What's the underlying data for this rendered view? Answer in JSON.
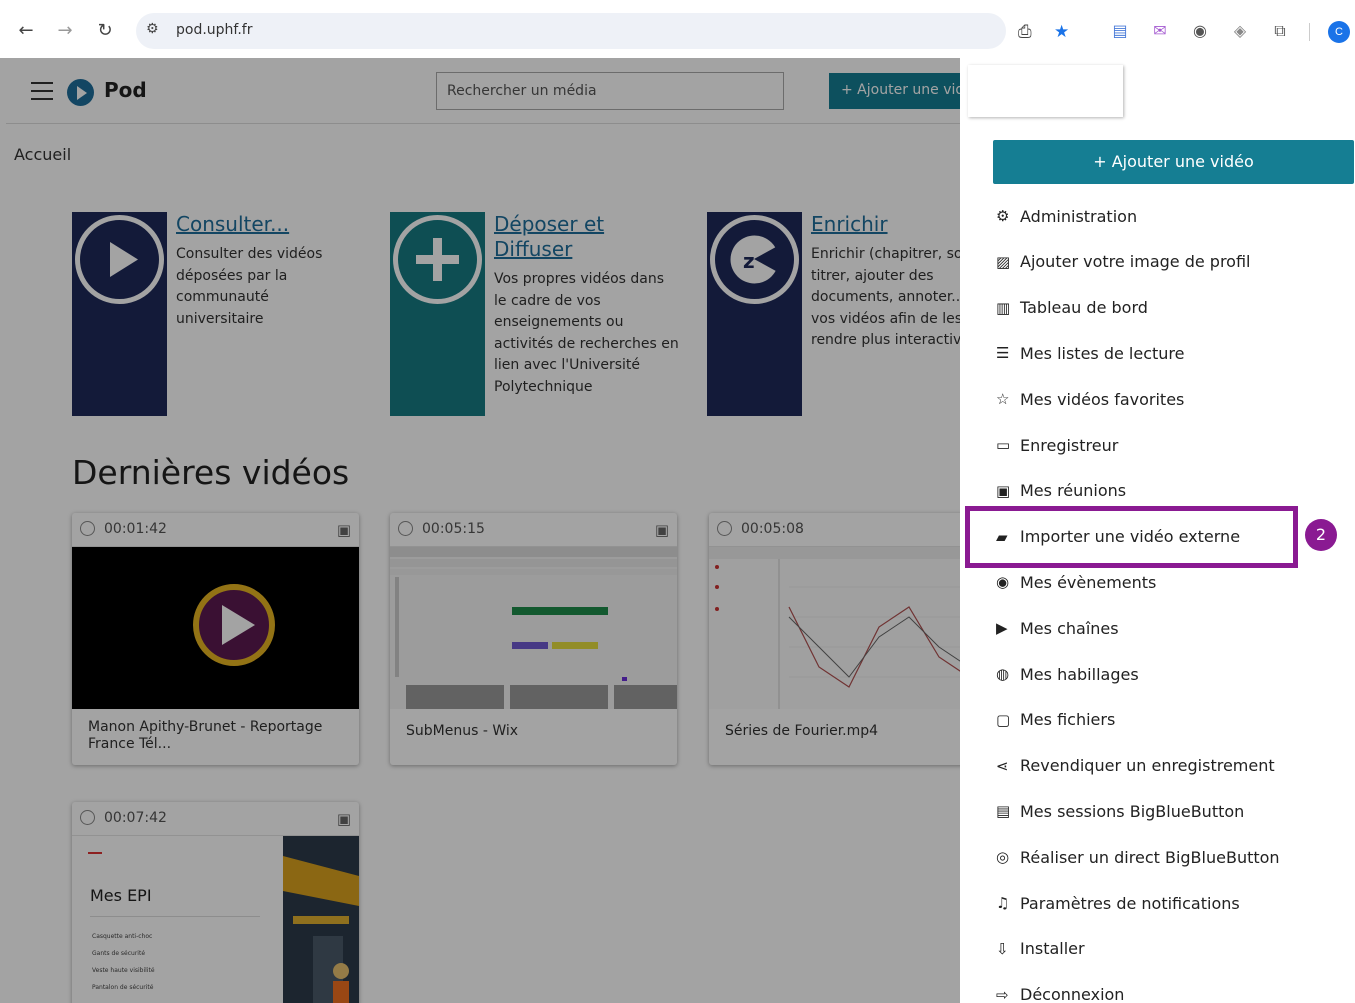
{
  "browser": {
    "url": "pod.uphf.fr",
    "profile_initial": "C"
  },
  "app": {
    "name": "Pod",
    "search_placeholder": "Rechercher un média",
    "add_button_top": "+  Ajouter une vidéo",
    "breadcrumb": "Accueil"
  },
  "features": [
    {
      "title": "Consulter...",
      "description": "Consulter des vidéos déposées par la communauté universitaire"
    },
    {
      "title": "Déposer et Diffuser",
      "description": "Vos propres vidéos dans le cadre de vos enseignements ou activités de recherches en lien avec l'Université Polytechnique"
    },
    {
      "title": "Enrichir",
      "description": "Enrichir (chapitrer, sous-titrer, ajouter des documents, annoter...) vos vidéos afin de les rendre plus interactives"
    }
  ],
  "latest": {
    "heading": "Dernières vidéos",
    "videos": [
      {
        "duration": "00:01:42",
        "title": "Manon Apithy-Brunet - Reportage France Tél..."
      },
      {
        "duration": "00:05:15",
        "title": "SubMenus - Wix"
      },
      {
        "duration": "00:05:08",
        "title": "Séries de Fourier.mp4"
      },
      {
        "duration": "00:07:42",
        "title": "Mes EPI",
        "bullets": [
          "Casquette anti-choc",
          "Gants de sécurité",
          "Veste haute visibilité",
          "Pantalon de sécurité"
        ]
      }
    ]
  },
  "menu": {
    "add_button": "+ Ajouter une vidéo",
    "items": [
      {
        "label": "Administration",
        "icon": "gear-box-icon"
      },
      {
        "label": "Ajouter votre image de profil",
        "icon": "image-icon"
      },
      {
        "label": "Tableau de bord",
        "icon": "film-icon"
      },
      {
        "label": "Mes listes de lecture",
        "icon": "list-icon"
      },
      {
        "label": "Mes vidéos favorites",
        "icon": "star-icon"
      },
      {
        "label": "Enregistreur",
        "icon": "camera-icon"
      },
      {
        "label": "Mes réunions",
        "icon": "person-box-icon"
      },
      {
        "label": "Importer une vidéo externe",
        "icon": "import-video-icon"
      },
      {
        "label": "Mes évènements",
        "icon": "broadcast-icon"
      },
      {
        "label": "Mes chaînes",
        "icon": "play-box-icon"
      },
      {
        "label": "Mes habillages",
        "icon": "palette-icon"
      },
      {
        "label": "Mes fichiers",
        "icon": "folder-icon"
      },
      {
        "label": "Revendiquer un enregistrement",
        "icon": "share-icon"
      },
      {
        "label": "Mes sessions BigBlueButton",
        "icon": "presentation-icon"
      },
      {
        "label": "Réaliser un direct BigBlueButton",
        "icon": "live-icon"
      },
      {
        "label": "Paramètres de notifications",
        "icon": "bell-icon"
      },
      {
        "label": "Installer",
        "icon": "install-icon"
      },
      {
        "label": "Déconnexion",
        "icon": "logout-icon"
      }
    ],
    "highlight_step": "2"
  },
  "colors": {
    "navy": "#1e2a59",
    "teal": "#167a82",
    "accent": "#157e93",
    "highlight": "#8a1a92"
  }
}
